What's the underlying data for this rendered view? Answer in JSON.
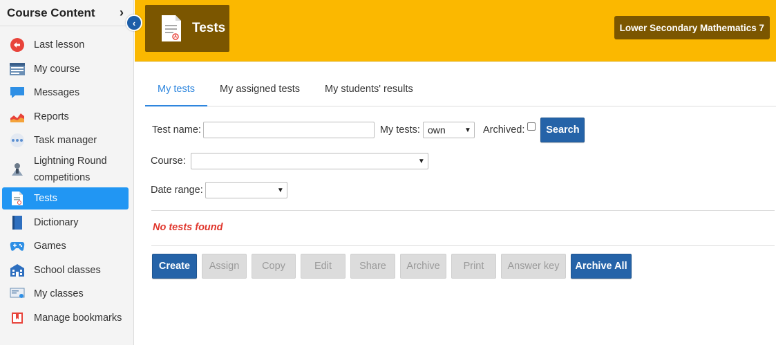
{
  "sidebar": {
    "title": "Course Content",
    "items": [
      {
        "label": "Last lesson",
        "icon": "back-arrow-icon"
      },
      {
        "label": "My course",
        "icon": "course-icon"
      },
      {
        "label": "Messages",
        "icon": "message-icon"
      },
      {
        "label": "Reports",
        "icon": "chart-icon"
      },
      {
        "label": "Task manager",
        "icon": "task-icon"
      },
      {
        "label_line1": "Lightning Round",
        "label_line2": "competitions",
        "icon": "trophy-icon"
      },
      {
        "label": "Tests",
        "icon": "test-document-icon",
        "active": true
      },
      {
        "label": "Dictionary",
        "icon": "book-icon"
      },
      {
        "label": "Games",
        "icon": "gamepad-icon"
      },
      {
        "label": "School classes",
        "icon": "school-icon"
      },
      {
        "label": "My classes",
        "icon": "classroom-icon"
      },
      {
        "label": "Manage bookmarks",
        "icon": "bookmark-icon"
      }
    ]
  },
  "header": {
    "page_title": "Tests",
    "course": "Lower Secondary Mathematics 7",
    "accent_color": "#fbb800",
    "badge_color": "#7b5600"
  },
  "tabs": [
    {
      "label": "My tests",
      "active": true
    },
    {
      "label": "My assigned tests"
    },
    {
      "label": "My students' results"
    }
  ],
  "filters": {
    "test_name_label": "Test name:",
    "test_name_value": "",
    "my_tests_label": "My tests:",
    "my_tests_value": "own",
    "archived_label": "Archived:",
    "search_label": "Search",
    "course_label": "Course:",
    "course_value": "",
    "date_range_label": "Date range:",
    "date_range_value": ""
  },
  "results": {
    "empty_message": "No tests found"
  },
  "actions": {
    "create": "Create",
    "assign": "Assign",
    "copy": "Copy",
    "edit": "Edit",
    "share": "Share",
    "archive": "Archive",
    "print": "Print",
    "answer_key": "Answer key",
    "archive_all": "Archive All"
  }
}
